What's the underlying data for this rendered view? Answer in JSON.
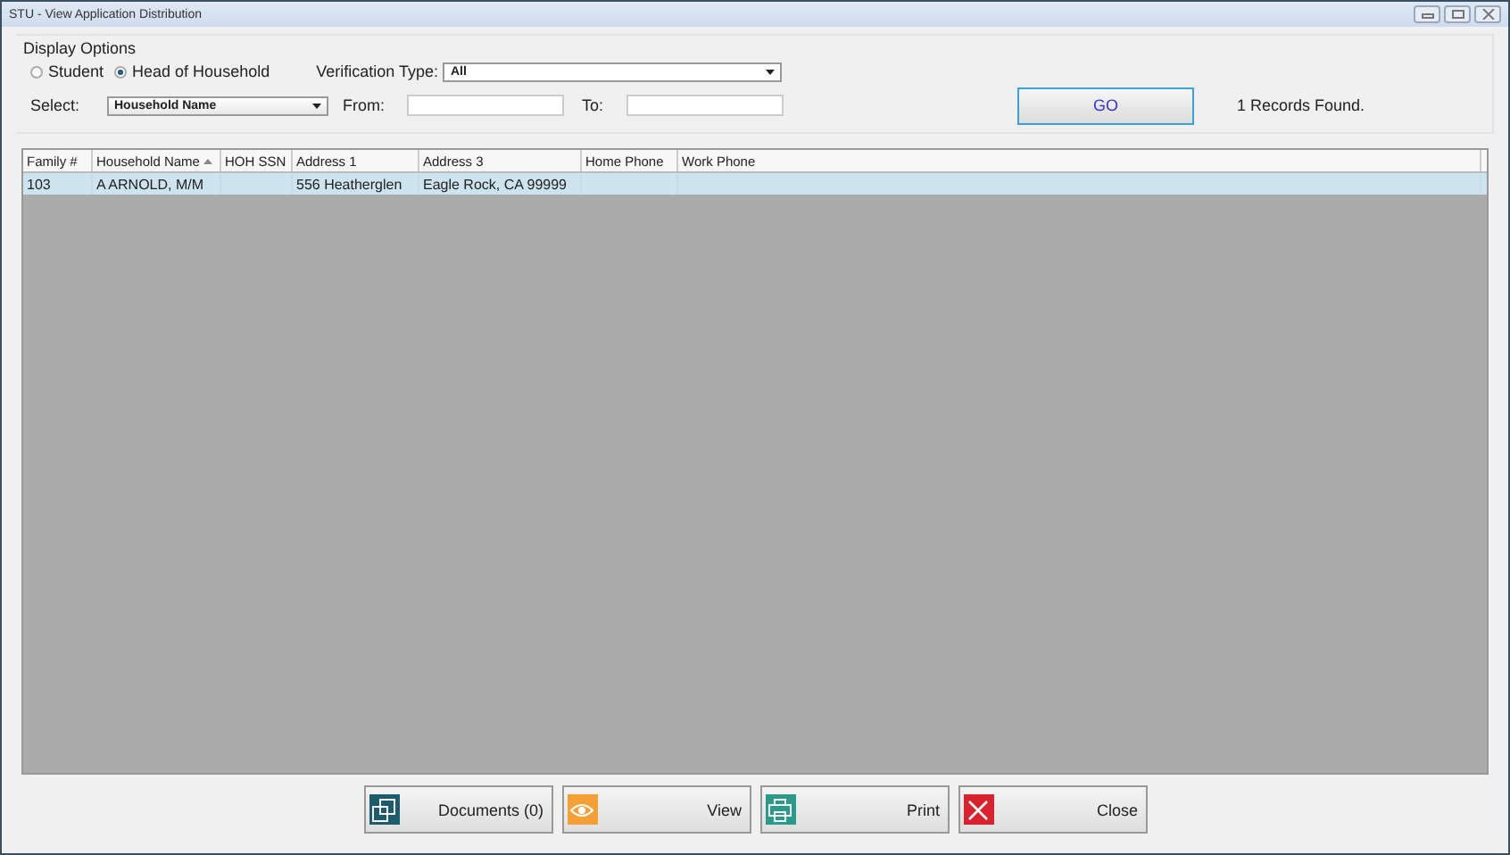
{
  "window": {
    "title": "STU - View Application Distribution"
  },
  "display_options": {
    "label": "Display Options",
    "radios": [
      {
        "label": "Student",
        "selected": false
      },
      {
        "label": "Head of Household",
        "selected": true
      }
    ],
    "verification": {
      "label": "Verification Type:",
      "value": "All"
    },
    "select": {
      "label": "Select:",
      "value": "Household Name"
    },
    "from": {
      "label": "From:"
    },
    "to": {
      "label": "To:"
    },
    "go_button": "GO",
    "records": "1 Records Found."
  },
  "table": {
    "columns": [
      {
        "label": "Family #",
        "sorted": false
      },
      {
        "label": "Household Name",
        "sorted": true
      },
      {
        "label": "HOH SSN",
        "sorted": false
      },
      {
        "label": "Address 1",
        "sorted": false
      },
      {
        "label": "Address 3",
        "sorted": false
      },
      {
        "label": "Home Phone",
        "sorted": false
      },
      {
        "label": "Work Phone",
        "sorted": false
      }
    ],
    "rows": [
      {
        "selected": true,
        "cells": [
          "103",
          "A ARNOLD, M/M",
          "",
          "556 Heatherglen",
          "Eagle Rock, CA 99999",
          "",
          ""
        ]
      }
    ]
  },
  "buttons": [
    {
      "kind": "documents",
      "label": "Documents (0)"
    },
    {
      "kind": "view",
      "label": "View"
    },
    {
      "kind": "print",
      "label": "Print"
    },
    {
      "kind": "close",
      "label": "Close"
    }
  ]
}
